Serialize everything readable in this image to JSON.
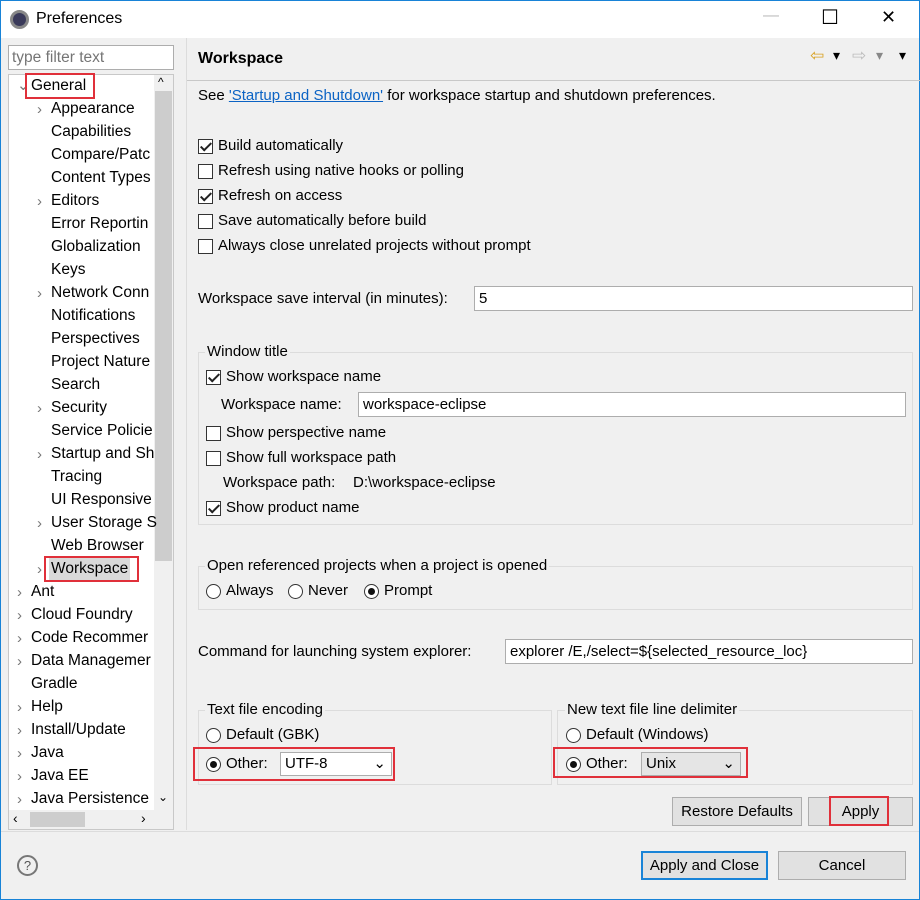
{
  "window": {
    "title": "Preferences",
    "minimize": "—",
    "maximize": "☐",
    "close": "✕"
  },
  "filter": {
    "placeholder": "type filter text"
  },
  "tree": {
    "items": [
      {
        "label": "General",
        "expanded": true,
        "level": 0,
        "twisty": "⌄"
      },
      {
        "label": "Appearance",
        "level": 1,
        "twisty": "›"
      },
      {
        "label": "Capabilities",
        "level": 1
      },
      {
        "label": "Compare/Patc",
        "level": 1
      },
      {
        "label": "Content Types",
        "level": 1
      },
      {
        "label": "Editors",
        "level": 1,
        "twisty": "›"
      },
      {
        "label": "Error Reportin",
        "level": 1
      },
      {
        "label": "Globalization",
        "level": 1
      },
      {
        "label": "Keys",
        "level": 1
      },
      {
        "label": "Network Conn",
        "level": 1,
        "twisty": "›"
      },
      {
        "label": "Notifications",
        "level": 1
      },
      {
        "label": "Perspectives",
        "level": 1
      },
      {
        "label": "Project Nature",
        "level": 1
      },
      {
        "label": "Search",
        "level": 1
      },
      {
        "label": "Security",
        "level": 1,
        "twisty": "›"
      },
      {
        "label": "Service Policie",
        "level": 1
      },
      {
        "label": "Startup and Sh",
        "level": 1,
        "twisty": "›"
      },
      {
        "label": "Tracing",
        "level": 1
      },
      {
        "label": "UI Responsive",
        "level": 1
      },
      {
        "label": "User Storage S",
        "level": 1,
        "twisty": "›"
      },
      {
        "label": "Web Browser",
        "level": 1
      },
      {
        "label": "Workspace",
        "level": 1,
        "twisty": "›",
        "selected": true
      },
      {
        "label": "Ant",
        "level": 0,
        "twisty": "›"
      },
      {
        "label": "Cloud Foundry",
        "level": 0,
        "twisty": "›"
      },
      {
        "label": "Code Recommer",
        "level": 0,
        "twisty": "›"
      },
      {
        "label": "Data Managemer",
        "level": 0,
        "twisty": "›"
      },
      {
        "label": "Gradle",
        "level": 0
      },
      {
        "label": "Help",
        "level": 0,
        "twisty": "›"
      },
      {
        "label": "Install/Update",
        "level": 0,
        "twisty": "›"
      },
      {
        "label": "Java",
        "level": 0,
        "twisty": "›"
      },
      {
        "label": "Java EE",
        "level": 0,
        "twisty": "›"
      },
      {
        "label": "Java Persistence",
        "level": 0,
        "twisty": "›"
      }
    ]
  },
  "page": {
    "title": "Workspace",
    "nav": {
      "back": "⇦",
      "forward": "⇨",
      "menu": "▾"
    },
    "intro_prefix": "See ",
    "intro_link": "'Startup and Shutdown'",
    "intro_suffix": " for workspace startup and shutdown preferences.",
    "checkboxes": [
      {
        "label": "Build automatically",
        "checked": true
      },
      {
        "label": "Refresh using native hooks or polling",
        "checked": false
      },
      {
        "label": "Refresh on access",
        "checked": true
      },
      {
        "label": "Save automatically before build",
        "checked": false
      },
      {
        "label": "Always close unrelated projects without prompt",
        "checked": false
      }
    ],
    "save_interval": {
      "label": "Workspace save interval (in minutes):",
      "value": "5"
    },
    "window_title": {
      "group_label": "Window title",
      "show_workspace_name": {
        "label": "Show workspace name",
        "checked": true
      },
      "workspace_name_label": "Workspace name:",
      "workspace_name_value": "workspace-eclipse",
      "show_perspective_name": {
        "label": "Show perspective name",
        "checked": false
      },
      "show_full_path": {
        "label": "Show full workspace path",
        "checked": false
      },
      "workspace_path_label": "Workspace path:",
      "workspace_path_value": "D:\\workspace-eclipse",
      "show_product_name": {
        "label": "Show product name",
        "checked": true
      }
    },
    "open_referenced": {
      "group_label": "Open referenced projects when a project is opened",
      "options": [
        "Always",
        "Never",
        "Prompt"
      ],
      "selected": "Prompt"
    },
    "command": {
      "label": "Command for launching system explorer:",
      "value": "explorer /E,/select=${selected_resource_loc}"
    },
    "encoding": {
      "group_label": "Text file encoding",
      "default_label": "Default (GBK)",
      "other_label": "Other:",
      "other_value": "UTF-8",
      "selected": "Other"
    },
    "delimiter": {
      "group_label": "New text file line delimiter",
      "default_label": "Default (Windows)",
      "other_label": "Other:",
      "other_value": "Unix",
      "selected": "Other"
    },
    "restore_defaults": "Restore Defaults",
    "apply": "Apply"
  },
  "footer": {
    "help": "?",
    "apply_close": "Apply and Close",
    "cancel": "Cancel"
  },
  "colors": {
    "highlight": "#e0303a",
    "link": "#0b63c4",
    "accent": "#1883d7"
  }
}
